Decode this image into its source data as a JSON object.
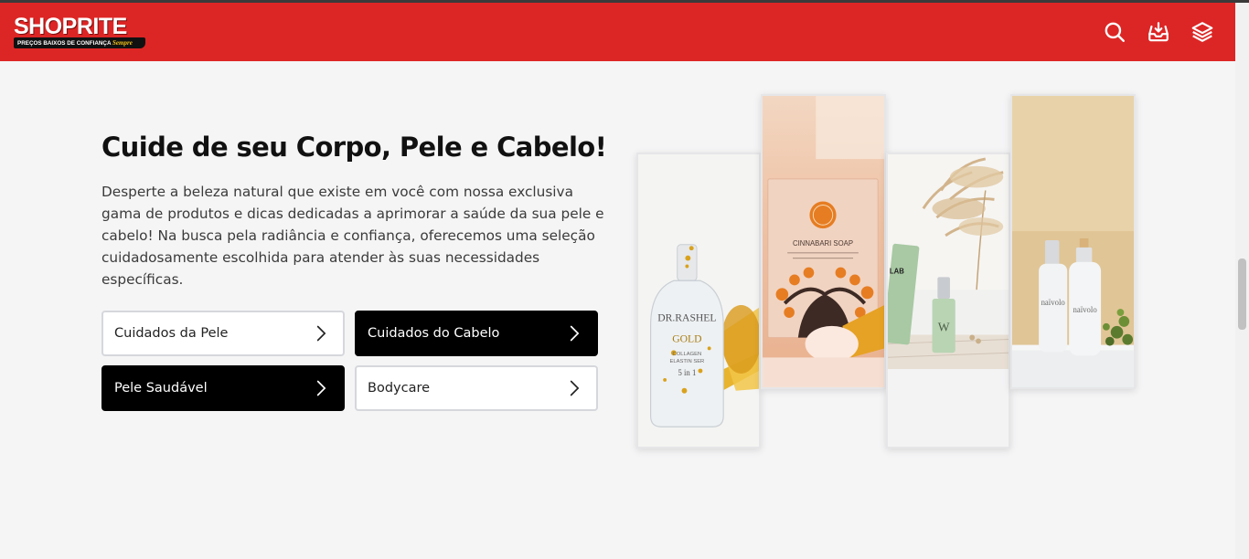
{
  "header": {
    "logo": {
      "brand": "SHOPRITE",
      "tagline": "PREÇOS BAIXOS DE CONFIANÇA",
      "tagline_accent": "Sempre"
    },
    "icons": [
      "search-icon",
      "inbox-icon",
      "layers-icon"
    ],
    "background_color": "#dc2625"
  },
  "main": {
    "title": "Cuide de seu Corpo, Pele e Cabelo!",
    "description": "Desperte a beleza natural que existe em você com nossa exclusiva gama de produtos e dicas dedicadas a aprimorar a saúde da sua pele e cabelo! Na busca pela radiância e confiança, oferecemos uma seleção cuidadosamente escolhida para atender às suas necessidades específicas.",
    "categories": [
      {
        "label": "Cuidados da Pele",
        "style": "light"
      },
      {
        "label": "Cuidados do Cabelo",
        "style": "dark"
      },
      {
        "label": "Pele Saudável",
        "style": "dark"
      },
      {
        "label": "Bodycare",
        "style": "light"
      }
    ]
  },
  "gallery": {
    "photos": [
      {
        "name": "serum-bottle-photo",
        "label_lines": [
          "DR.RASHEL",
          "GOLD",
          "COLLAGEN",
          "ELASTIN SER",
          "5 in 1"
        ]
      },
      {
        "name": "cinnabari-soap-photo",
        "label_lines": [
          "CINNABARI SOAP"
        ]
      },
      {
        "name": "skincare-tubes-photo",
        "label_lines": [
          "LAB",
          "W"
        ]
      },
      {
        "name": "bodycare-bottles-photo",
        "label_lines": [
          "naïvolo",
          "naïvolo"
        ]
      }
    ]
  },
  "colors": {
    "accent": "#dc2625",
    "dark_button": "#000000",
    "page_bg": "#f5f5f6"
  }
}
